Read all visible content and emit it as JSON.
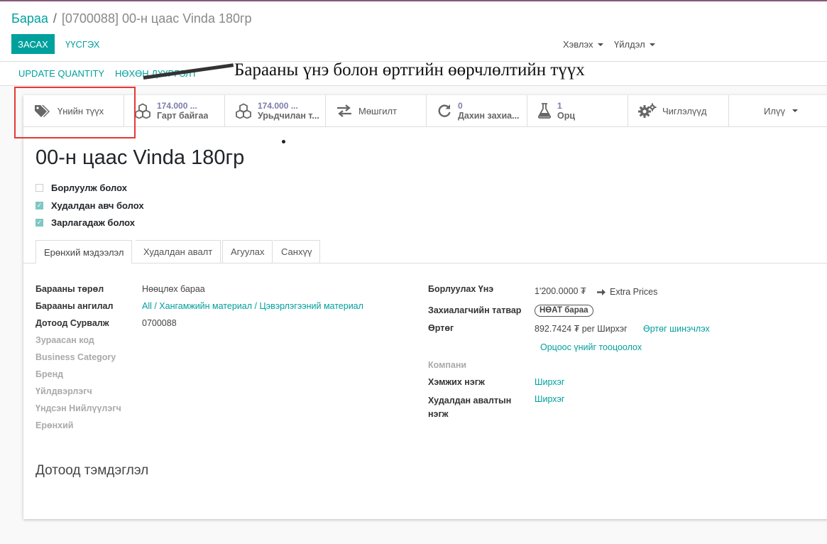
{
  "breadcrumb": {
    "parent": "Бараа",
    "separator": "/",
    "current": "[0700088] 00-н цаас Vinda 180гр"
  },
  "control": {
    "edit_label": "ЗАСАХ",
    "create_label": "ҮҮСГЭХ",
    "print_label": "Хэвлэх",
    "action_label": "Үйлдэл"
  },
  "header": {
    "update_qty_label": "UPDATE QUANTITY",
    "replenish_label": "НӨХӨН ДҮҮРГЭЛТ"
  },
  "annotation": {
    "text": "Барааны үнэ болон өртгийн өөрчлөлтийн түүх"
  },
  "smart_buttons": {
    "price_history": {
      "label": "Үнийн түүх",
      "icon": "tags-icon"
    },
    "on_hand": {
      "value": "174.000 ...",
      "label": "Гарт байгаа",
      "icon": "cubes-icon"
    },
    "forecasted": {
      "value": "174.000 ...",
      "label": "Урьдчилан т...",
      "icon": "cubes-icon"
    },
    "moves": {
      "label": "Мөшгилт",
      "icon": "exchange-icon"
    },
    "reorder": {
      "value": "0",
      "label": "Дахин захиа...",
      "icon": "refresh-icon"
    },
    "bom": {
      "value": "1",
      "label": "Орц",
      "icon": "flask-icon"
    },
    "routes": {
      "label": "Чиглэлүүд",
      "icon": "cogs-icon"
    },
    "more": {
      "label": "Илүү"
    }
  },
  "product": {
    "name": "00-н цаас Vinda 180гр",
    "checks": [
      {
        "label": "Борлуулж болох",
        "checked": false
      },
      {
        "label": "Худалдан авч болох",
        "checked": true
      },
      {
        "label": "Зарлагадаж болох",
        "checked": true
      }
    ]
  },
  "tabs": [
    "Ерөнхий мэдээлэл",
    "Худалдан авалт",
    "Агуулах",
    "Санхүү"
  ],
  "left_fields": {
    "type": {
      "label": "Барааны төрөл",
      "value": "Нөөцлөх бараа"
    },
    "category": {
      "label": "Барааны ангилал",
      "value": "All / Хангамжийн материал / Цэвэрлэгээний материал"
    },
    "ref": {
      "label": "Дотоод Сурвалж",
      "value": "0700088"
    },
    "barcode": {
      "label": "Зураасан код"
    },
    "business_category": {
      "label": "Business Category"
    },
    "brand": {
      "label": "Бренд"
    },
    "manufacturer": {
      "label": "Үйлдвэрлэгч"
    },
    "supplier": {
      "label": "Үндсэн Нийлүүлэгч"
    },
    "general": {
      "label": "Ерөнхий"
    }
  },
  "right_fields": {
    "sale_price": {
      "label": "Борлуулах Үнэ",
      "value": "1'200.0000 ₮",
      "extra": "Extra Prices"
    },
    "customer_tax": {
      "label": "Захиалагчийн татвар",
      "value": "НӨАТ бараа"
    },
    "cost": {
      "label": "Өртөг",
      "value": "892.7424 ₮ per Ширхэг",
      "update_link": "Өртөг шинэчлэх",
      "bom_link": "Орцоос үнийг тооцоолох"
    },
    "company": {
      "label": "Компани"
    },
    "uom": {
      "label": "Хэмжих нэгж",
      "value": "Ширхэг"
    },
    "purchase_uom": {
      "label": "Худалдан авалтын нэгж",
      "value": "Ширхэг"
    }
  },
  "notes": {
    "title": "Дотоод тэмдэглэл"
  },
  "colors": {
    "primary": "#00a09d",
    "brand": "#875a7b",
    "annotation_box": "#e53935"
  }
}
